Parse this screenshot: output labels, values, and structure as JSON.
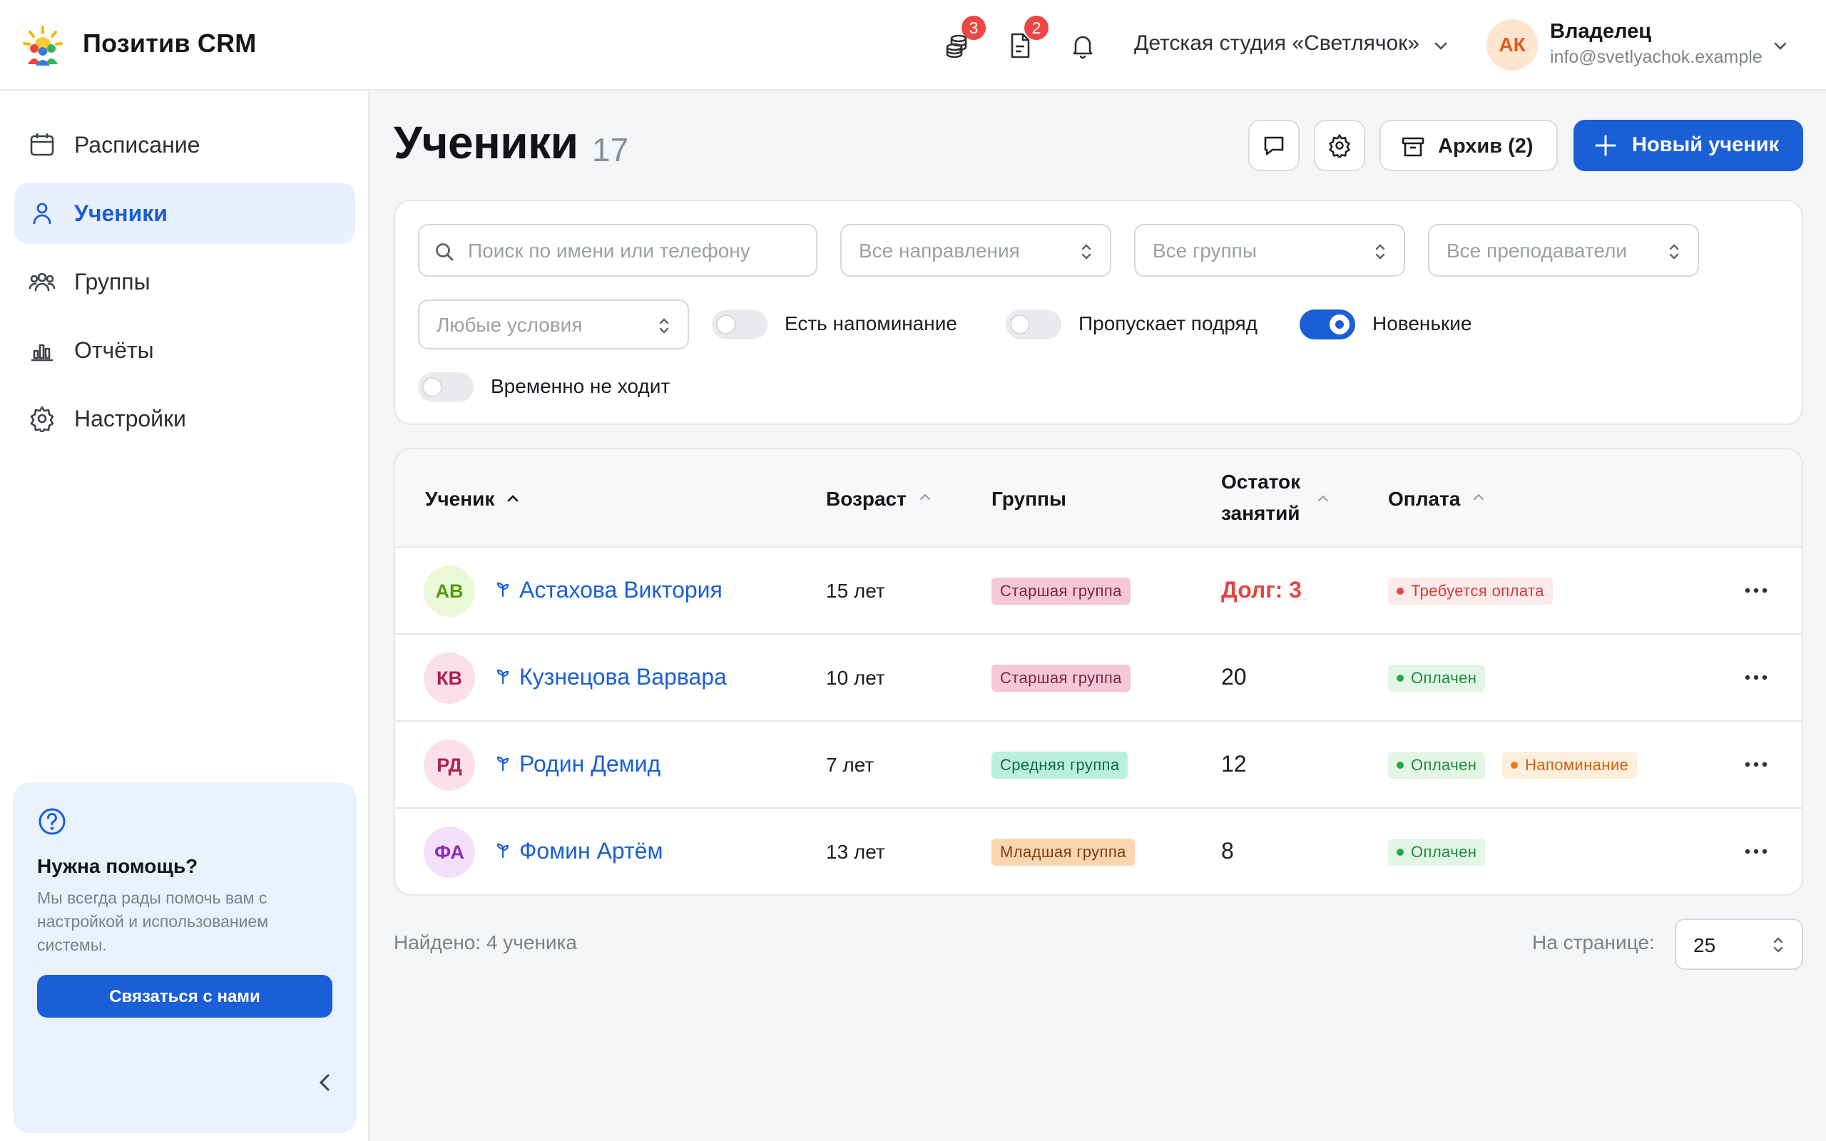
{
  "app": {
    "title": "Позитив CRM"
  },
  "topbar": {
    "billing_badge": "3",
    "docs_badge": "2",
    "studio": "Детская студия «Светлячок»",
    "user": {
      "initials": "АК",
      "role": "Владелец",
      "email": "info@svetlyachok.example"
    }
  },
  "sidebar": {
    "items": [
      {
        "label": "Расписание",
        "icon": "calendar-icon"
      },
      {
        "label": "Ученики",
        "icon": "user-icon",
        "active": true
      },
      {
        "label": "Группы",
        "icon": "users-icon"
      },
      {
        "label": "Отчёты",
        "icon": "chart-icon"
      },
      {
        "label": "Настройки",
        "icon": "gear-icon"
      }
    ],
    "help": {
      "title": "Нужна помощь?",
      "text": "Мы всегда рады помочь вам с настройкой и использованием системы.",
      "button": "Связаться с нами"
    }
  },
  "header": {
    "title": "Ученики",
    "count": "17",
    "archive_label": "Архив (2)",
    "new_label": "Новый ученик"
  },
  "filters": {
    "search_placeholder": "Поиск по имени или телефону",
    "directions": "Все направления",
    "groups": "Все группы",
    "teachers": "Все преподаватели",
    "conditions": "Любые условия",
    "toggles": [
      {
        "label": "Есть напоминание",
        "on": false
      },
      {
        "label": "Пропускает подряд",
        "on": false
      },
      {
        "label": "Новенькие",
        "on": true
      },
      {
        "label": "Временно не ходит",
        "on": false
      }
    ]
  },
  "table": {
    "columns": {
      "student": "Ученик",
      "age": "Возраст",
      "groups": "Группы",
      "remaining_1": "Остаток",
      "remaining_2": "занятий",
      "payment": "Оплата"
    },
    "rows": [
      {
        "initials": "АВ",
        "name": "Астахова Виктория",
        "age": "15 лет",
        "group": "Старшая группа",
        "remaining": "Долг: 3",
        "payment": "Требуется оплата",
        "reminder": ""
      },
      {
        "initials": "КВ",
        "name": "Кузнецова Варвара",
        "age": "10 лет",
        "group": "Старшая группа",
        "remaining": "20",
        "payment": "Оплачен",
        "reminder": ""
      },
      {
        "initials": "РД",
        "name": "Родин Демид",
        "age": "7 лет",
        "group": "Средняя группа",
        "remaining": "12",
        "payment": "Оплачен",
        "reminder": "Напоминание"
      },
      {
        "initials": "ФА",
        "name": "Фомин Артём",
        "age": "13 лет",
        "group": "Младшая группа",
        "remaining": "8",
        "payment": "Оплачен",
        "reminder": ""
      }
    ]
  },
  "footer": {
    "found": "Найдено: 4 ученика",
    "per_page_label": "На странице:",
    "per_page_value": "25"
  },
  "colors": {
    "accent": "#1a5fd6",
    "debt": "#e34545",
    "paid": "#27a84a",
    "reminder": "#f07a1a"
  }
}
